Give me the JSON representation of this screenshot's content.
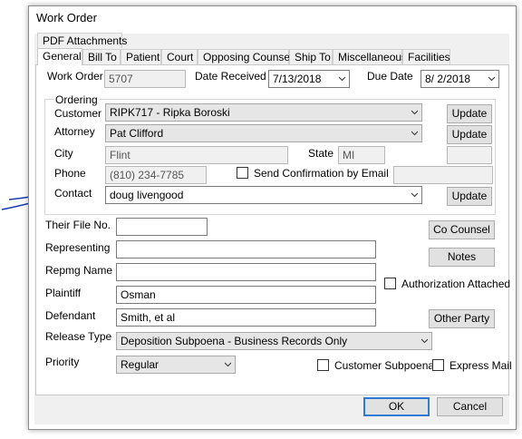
{
  "dialog_title": "Work Order",
  "tabs_row1": [
    "PDF Attachments"
  ],
  "tabs_row2": [
    "General",
    "Bill To",
    "Patient",
    "Court",
    "Opposing Counsel",
    "Ship To",
    "Miscellaneous",
    "Facilities"
  ],
  "work_order": {
    "label": "Work Order",
    "value": "5707"
  },
  "date_received": {
    "label": "Date Received",
    "value": "7/13/2018"
  },
  "due_date": {
    "label": "Due Date",
    "value": "8/  2/2018"
  },
  "ordering": {
    "group_label": "Ordering",
    "customer": {
      "label": "Customer",
      "value": "RIPK717 - Ripka Boroski",
      "button": "Update"
    },
    "attorney": {
      "label": "Attorney",
      "value": "Pat Clifford",
      "button": "Update"
    },
    "city": {
      "label": "City",
      "value": "Flint"
    },
    "state": {
      "label": "State",
      "value": "MI"
    },
    "phone": {
      "label": "Phone",
      "value": "(810) 234-7785"
    },
    "send_confirmation": {
      "label": "Send Confirmation by Email",
      "checked": false
    },
    "contact": {
      "label": "Contact",
      "value": "doug livengood",
      "button": "Update"
    }
  },
  "their_file_no": {
    "label": "Their File No.",
    "value": ""
  },
  "representing": {
    "label": "Representing",
    "value": ""
  },
  "repmg_name": {
    "label": "Repmg Name",
    "value": ""
  },
  "plaintiff": {
    "label": "Plaintiff",
    "value": "Osman"
  },
  "defendant": {
    "label": "Defendant",
    "value": "Smith, et al"
  },
  "release_type": {
    "label": "Release Type",
    "value": "Deposition Subpoena - Business Records Only"
  },
  "priority": {
    "label": "Priority",
    "value": "Regular"
  },
  "buttons": {
    "co_counsel": "Co Counsel",
    "notes": "Notes",
    "other_party": "Other Party",
    "ok": "OK",
    "cancel": "Cancel"
  },
  "checkboxes": {
    "authorization_attached": {
      "label": "Authorization Attached",
      "checked": false
    },
    "customer_subpoena": {
      "label": "Customer Subpoena",
      "checked": false
    },
    "express_mail": {
      "label": "Express Mail",
      "checked": false
    }
  },
  "annotation_color": "#1a3fa8"
}
